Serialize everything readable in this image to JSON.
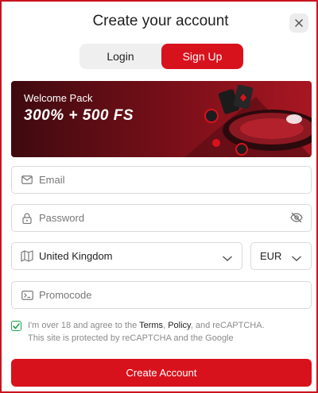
{
  "header": {
    "title": "Create your account",
    "close_icon": "close-icon"
  },
  "tabs": [
    {
      "label": "Login",
      "active": false
    },
    {
      "label": "Sign Up",
      "active": true
    }
  ],
  "banner": {
    "subtitle": "Welcome Pack",
    "headline": "300% + 500 FS"
  },
  "form": {
    "email": {
      "placeholder": "Email",
      "icon": "envelope-icon"
    },
    "password": {
      "placeholder": "Password",
      "icon": "lock-icon",
      "toggle_icon": "eye-off-icon"
    },
    "country": {
      "value": "United Kingdom",
      "icon": "map-icon"
    },
    "currency": {
      "value": "EUR"
    },
    "promocode": {
      "placeholder": "Promocode",
      "icon": "ticket-icon"
    }
  },
  "consent": {
    "checked": true,
    "prefix": "I'm over 18 and agree to the ",
    "terms": "Terms",
    "comma": ", ",
    "policy": "Policy",
    "suffix": ", and reCAPTCHA.",
    "line2": "This site is protected by reCAPTCHA and the Google"
  },
  "submit": {
    "label": "Create Account"
  },
  "colors": {
    "accent": "#d8121d",
    "check": "#1aa34a",
    "banner_dark": "#3e0a0f"
  }
}
